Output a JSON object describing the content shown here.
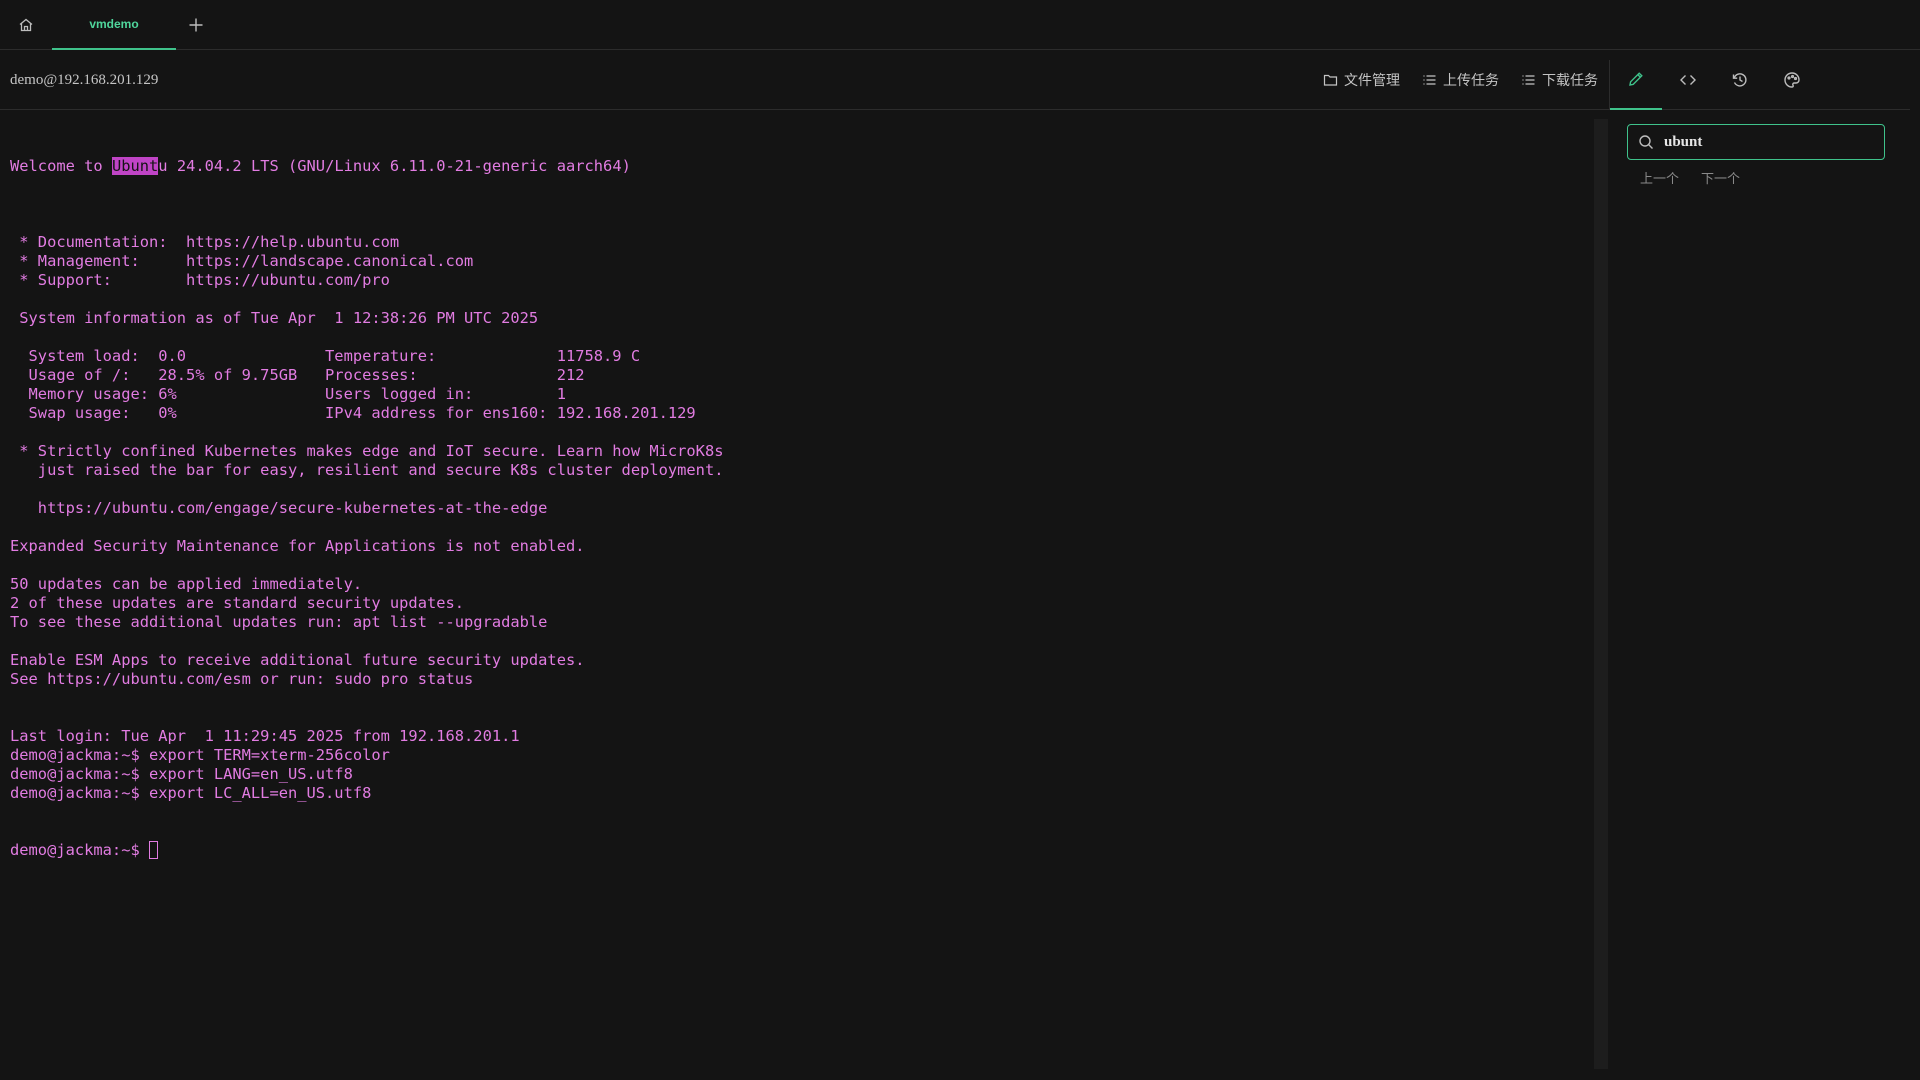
{
  "tabs": {
    "active_label": "vmdemo"
  },
  "header": {
    "host": "demo@192.168.201.129",
    "actions": [
      {
        "label": "文件管理",
        "icon": "folder-icon"
      },
      {
        "label": "上传任务",
        "icon": "list-icon"
      },
      {
        "label": "下载任务",
        "icon": "list-icon"
      }
    ],
    "tools": [
      "edit-icon",
      "code-icon",
      "history-icon",
      "palette-icon"
    ]
  },
  "colors": {
    "accent": "#3fc28b",
    "terminal_text": "#e27ce2",
    "highlight": "#c044c6",
    "background": "#141414"
  },
  "terminal": {
    "welcome_prefix": "Welcome to ",
    "welcome_match": "Ubunt",
    "welcome_suffix": "u 24.04.2 LTS (GNU/Linux 6.11.0-21-generic aarch64)",
    "lines": [
      "",
      " * Documentation:  https://help.ubuntu.com",
      " * Management:     https://landscape.canonical.com",
      " * Support:        https://ubuntu.com/pro",
      "",
      " System information as of Tue Apr  1 12:38:26 PM UTC 2025",
      "",
      "  System load:  0.0               Temperature:             11758.9 C",
      "  Usage of /:   28.5% of 9.75GB   Processes:               212",
      "  Memory usage: 6%                Users logged in:         1",
      "  Swap usage:   0%                IPv4 address for ens160: 192.168.201.129",
      "",
      " * Strictly confined Kubernetes makes edge and IoT secure. Learn how MicroK8s",
      "   just raised the bar for easy, resilient and secure K8s cluster deployment.",
      "",
      "   https://ubuntu.com/engage/secure-kubernetes-at-the-edge",
      "",
      "Expanded Security Maintenance for Applications is not enabled.",
      "",
      "50 updates can be applied immediately.",
      "2 of these updates are standard security updates.",
      "To see these additional updates run: apt list --upgradable",
      "",
      "Enable ESM Apps to receive additional future security updates.",
      "See https://ubuntu.com/esm or run: sudo pro status",
      "",
      "",
      "Last login: Tue Apr  1 11:29:45 2025 from 192.168.201.1",
      "demo@jackma:~$ export TERM=xterm-256color",
      "demo@jackma:~$ export LANG=en_US.utf8",
      "demo@jackma:~$ export LC_ALL=en_US.utf8"
    ],
    "prompt": "demo@jackma:~$ "
  },
  "search": {
    "value": "ubunt",
    "prev_label": "上一个",
    "next_label": "下一个"
  }
}
